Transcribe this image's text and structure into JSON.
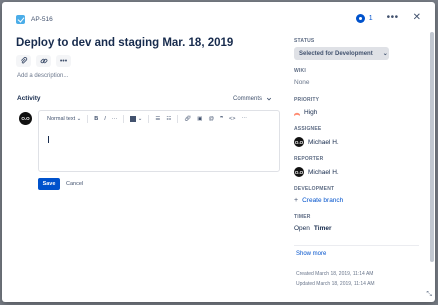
{
  "issue": {
    "key": "AP-516",
    "watch_count": "1",
    "title": "Deploy to dev and staging Mar. 18, 2019",
    "add_description": "Add a description..."
  },
  "activity": {
    "heading": "Activity",
    "filter": "Comments",
    "avatar_initials": "O.O",
    "toolbar": {
      "text_style": "Normal text",
      "bold": "B",
      "italic": "I",
      "more": "···"
    },
    "save_label": "Save",
    "cancel_label": "Cancel"
  },
  "sidebar": {
    "status_label": "STATUS",
    "status_value": "Selected for Development",
    "wiki_label": "WIKI",
    "wiki_value": "None",
    "priority_label": "PRIORITY",
    "priority_value": "High",
    "assignee_label": "ASSIGNEE",
    "assignee_value": "Michael H.",
    "reporter_label": "REPORTER",
    "reporter_value": "Michael H.",
    "development_label": "DEVELOPMENT",
    "development_value": "Create branch",
    "timer_label": "TIMER",
    "timer_value_prefix": "Open",
    "timer_value_strong": "Timer",
    "show_more": "Show more",
    "created": "Created March 18, 2019, 11:14 AM",
    "updated": "Updated March 18, 2019, 11:14 AM"
  },
  "icons": [
    "check-icon",
    "eye-icon",
    "more-icon",
    "close-icon",
    "attach-icon",
    "link-icon",
    "priority-high-icon",
    "plus-icon",
    "chevron-down-icon"
  ],
  "colors": {
    "accent": "#0052cc",
    "priority": "#ff5630",
    "issue_type": "#4bade8"
  }
}
